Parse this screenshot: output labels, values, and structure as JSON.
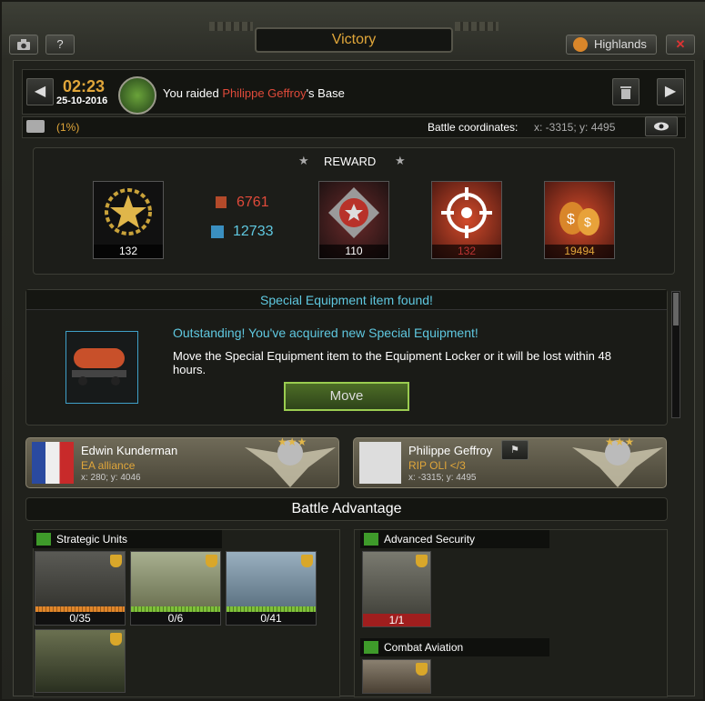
{
  "window": {
    "title": "Victory",
    "camera_icon": "camera-icon",
    "help_label": "?",
    "region": "Highlands",
    "close_label": "✕"
  },
  "battle": {
    "time": "02:23",
    "date": "25-10-2016",
    "message_prefix": "You raided ",
    "opponent": "Philippe Geffroy",
    "message_suffix": "'s Base",
    "percent": "(1%)",
    "coords_label": "Battle coordinates:",
    "coords_value": "x: -3315; y: 4495"
  },
  "reward": {
    "title": "REWARD",
    "medal_count": "132",
    "resource1": "6761",
    "resource2": "12733",
    "rank_count": "110",
    "target_count": "132",
    "money_count": "19494"
  },
  "special_equipment": {
    "title": "Special Equipment item found!",
    "headline": "Outstanding! You've acquired new Special Equipment!",
    "body": "Move the Special Equipment item to the Equipment Locker or it will be lost within 48 hours.",
    "move_button": "Move"
  },
  "player": {
    "name": "Edwin Kunderman",
    "alliance": "EA alliance",
    "coords": "x: 280; y: 4046"
  },
  "enemy": {
    "name": "Philippe Geffroy",
    "alliance": "RIP OLI </3",
    "coords": "x: -3315; y: 4495"
  },
  "advantage": {
    "title": "Battle Advantage",
    "strategic_title": "Strategic Units",
    "units": [
      {
        "count": "0/35",
        "icon": "tank-icon"
      },
      {
        "count": "0/6",
        "icon": "apc-icon"
      },
      {
        "count": "0/41",
        "icon": "jet-icon"
      },
      {
        "count": "",
        "icon": "soldier-icon"
      }
    ],
    "security_title": "Advanced Security",
    "security_count": "1/1",
    "aviation_title": "Combat Aviation"
  },
  "colors": {
    "accent": "#e0a63a",
    "cyan": "#5fc8e0",
    "red": "#e04a3a",
    "green": "#7fc13a"
  }
}
